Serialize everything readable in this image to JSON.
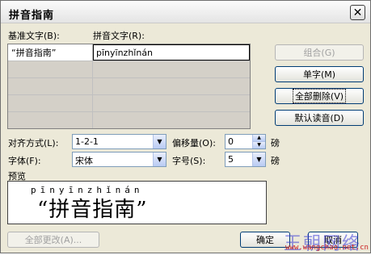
{
  "window": {
    "title": "拼音指南",
    "close_symbol": "✕"
  },
  "columns": {
    "base_label": "基准文字(B):",
    "pinyin_label": "拼音文字(R):"
  },
  "rows": [
    {
      "base": "“拼音指南”",
      "pinyin": "pīnyīnzhǐnán"
    },
    {
      "base": "",
      "pinyin": ""
    },
    {
      "base": "",
      "pinyin": ""
    },
    {
      "base": "",
      "pinyin": ""
    },
    {
      "base": "",
      "pinyin": ""
    }
  ],
  "buttons": {
    "combine": "组合(G)",
    "single_char": "单字(M)",
    "delete_all": "全部删除(V)",
    "default_reading": "默认读音(D)",
    "change_all": "全部更改(A)...",
    "ok": "确定",
    "cancel": "取消"
  },
  "options": {
    "alignment_label": "对齐方式(L):",
    "alignment_value": "1-2-1",
    "offset_label": "偏移量(O):",
    "offset_value": "0",
    "font_label": "字体(F):",
    "font_value": "宋体",
    "size_label": "字号(S):",
    "size_value": "5",
    "unit": "磅"
  },
  "preview": {
    "label": "预览",
    "pinyin": "pīnyīnzhǐnán",
    "text": "“拼音指南”"
  },
  "watermark": {
    "brand": "王朝网络",
    "url": "www.wangchao.net.cn"
  },
  "icons": {
    "dropdown": "chevron-down-icon",
    "spin_up": "spin-up-icon",
    "spin_down": "spin-down-icon"
  }
}
